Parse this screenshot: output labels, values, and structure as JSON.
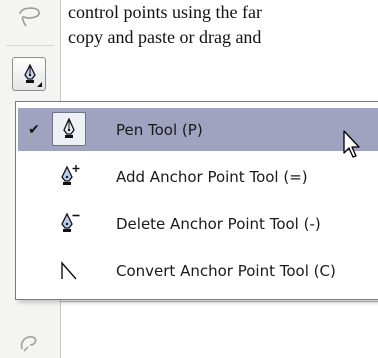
{
  "document": {
    "lines": [
      "control points using the far",
      "copy and paste or drag and"
    ]
  },
  "toolbar": {
    "lasso_icon": "lasso-icon",
    "pen_button_icon": "pen-icon",
    "bottom_icon": "freeform-icon"
  },
  "menu": {
    "items": [
      {
        "label": "Pen Tool (P)",
        "icon": "pen-icon",
        "checked": true,
        "selected": true
      },
      {
        "label": "Add Anchor Point Tool (=)",
        "icon": "add-anchor-icon",
        "checked": false,
        "selected": false
      },
      {
        "label": "Delete Anchor Point Tool (-)",
        "icon": "delete-anchor-icon",
        "checked": false,
        "selected": false
      },
      {
        "label": "Convert Anchor Point Tool (C)",
        "icon": "convert-anchor-icon",
        "checked": false,
        "selected": false
      }
    ],
    "check_glyph": "✔"
  },
  "colors": {
    "selection": "#9fa3c0",
    "menu_border": "#7b7b7b"
  }
}
